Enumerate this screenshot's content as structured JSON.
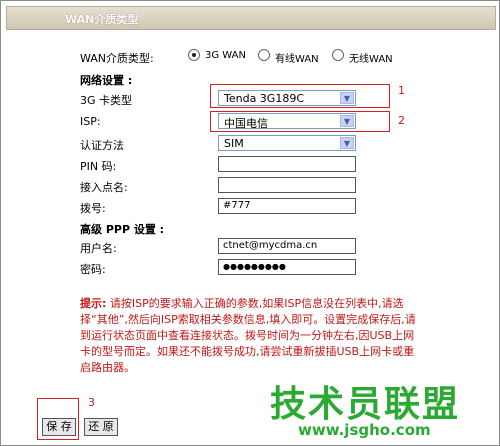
{
  "header": {
    "title": "WAN介质类型"
  },
  "wan_type": {
    "label": "WAN介质类型:",
    "options": [
      "3G WAN",
      "有线WAN",
      "无线WAN"
    ],
    "selected": "3G WAN"
  },
  "network": {
    "section_title": "网络设置 :",
    "card_type_label": "3G 卡类型",
    "card_type_value": "Tenda 3G189C",
    "isp_label": "ISP:",
    "isp_value": "中国电信",
    "auth_label": "认证方法",
    "auth_value": "SIM",
    "pin_label": "PIN 码:",
    "pin_value": "",
    "apn_label": "接入点名:",
    "apn_value": "",
    "dial_label": "拨号:",
    "dial_value": "#777"
  },
  "ppp": {
    "section_title": "高级 PPP 设置 :",
    "user_label": "用户名:",
    "user_value": "ctnet@mycdma.cn",
    "password_label": "密码:",
    "password_value": "●●●●●●●●●"
  },
  "annotations": {
    "one": "1",
    "two": "2",
    "three": "3"
  },
  "tips": {
    "title": "提示:",
    "text": "请按ISP的要求输入正确的参数,如果ISP信息没在列表中,请选择“其他”,然后向ISP索取相关参数信息,填入即可。设置完成保存后,请到运行状态页面中查看连接状态。拨号时间为一分钟左右,因USB上网卡的型号而定。如果还不能拨号成功,请尝试重新拔插USB上网卡或重启路由器。"
  },
  "buttons": {
    "save": "保 存",
    "restore": "还 原"
  },
  "watermark": {
    "text": "技术员联盟",
    "url": "www.jsgho.com"
  },
  "colors": {
    "annotation_red": "#d82020",
    "watermark_green": "#2aaa33",
    "tip_red": "#c01818"
  }
}
